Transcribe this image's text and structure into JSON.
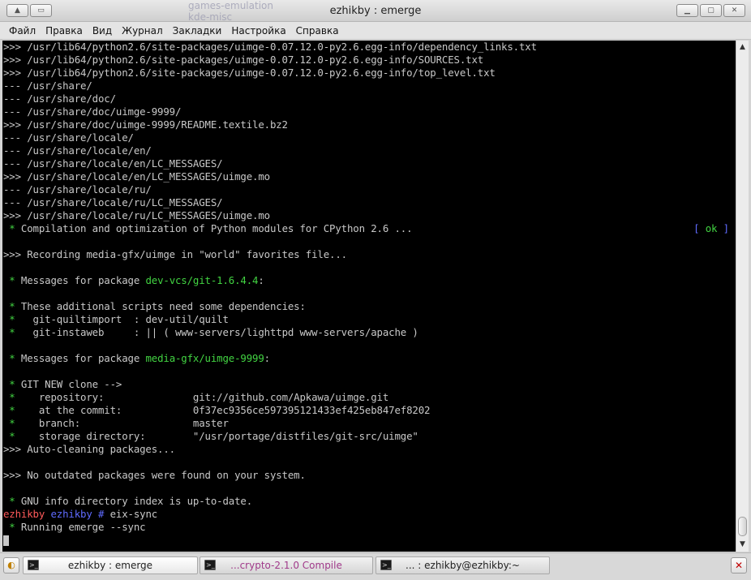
{
  "window": {
    "title": "ezhikby : emerge",
    "bg_items": [
      "games-emulation",
      "kde-misc"
    ]
  },
  "menu": [
    "Файл",
    "Правка",
    "Вид",
    "Журнал",
    "Закладки",
    "Настройка",
    "Справка"
  ],
  "terminal": {
    "lines": [
      [
        {
          "t": ">>> /usr/lib64/python2.6/site-packages/uimge-0.07.12.0-py2.6.egg-info/dependency_links.txt"
        }
      ],
      [
        {
          "t": ">>> /usr/lib64/python2.6/site-packages/uimge-0.07.12.0-py2.6.egg-info/SOURCES.txt"
        }
      ],
      [
        {
          "t": ">>> /usr/lib64/python2.6/site-packages/uimge-0.07.12.0-py2.6.egg-info/top_level.txt"
        }
      ],
      [
        {
          "t": "--- /usr/share/"
        }
      ],
      [
        {
          "t": "--- /usr/share/doc/"
        }
      ],
      [
        {
          "t": "--- /usr/share/doc/uimge-9999/"
        }
      ],
      [
        {
          "t": ">>> /usr/share/doc/uimge-9999/README.textile.bz2"
        }
      ],
      [
        {
          "t": "--- /usr/share/locale/"
        }
      ],
      [
        {
          "t": "--- /usr/share/locale/en/"
        }
      ],
      [
        {
          "t": "--- /usr/share/locale/en/LC_MESSAGES/"
        }
      ],
      [
        {
          "t": ">>> /usr/share/locale/en/LC_MESSAGES/uimge.mo"
        }
      ],
      [
        {
          "t": "--- /usr/share/locale/ru/"
        }
      ],
      [
        {
          "t": "--- /usr/share/locale/ru/LC_MESSAGES/"
        }
      ],
      [
        {
          "t": ">>> /usr/share/locale/ru/LC_MESSAGES/uimge.mo"
        }
      ],
      [
        {
          "t": " *",
          "c": "g"
        },
        {
          "t": " Compilation and optimization of Python modules for CPython 2.6 ..."
        },
        {
          "t": "[ ",
          "c": "b",
          "ok": true
        }
      ],
      [
        {
          "t": ""
        }
      ],
      [
        {
          "t": ">>> Recording media-gfx/uimge in \"world\" favorites file..."
        }
      ],
      [
        {
          "t": ""
        }
      ],
      [
        {
          "t": " *",
          "c": "g"
        },
        {
          "t": " Messages for package "
        },
        {
          "t": "dev-vcs/git-1.6.4.4",
          "c": "g"
        },
        {
          "t": ":"
        }
      ],
      [
        {
          "t": ""
        }
      ],
      [
        {
          "t": " *",
          "c": "g"
        },
        {
          "t": " These additional scripts need some dependencies:"
        }
      ],
      [
        {
          "t": " *",
          "c": "g"
        },
        {
          "t": "   git-quiltimport  : dev-util/quilt"
        }
      ],
      [
        {
          "t": " *",
          "c": "g"
        },
        {
          "t": "   git-instaweb     : || ( www-servers/lighttpd www-servers/apache )"
        }
      ],
      [
        {
          "t": ""
        }
      ],
      [
        {
          "t": " *",
          "c": "g"
        },
        {
          "t": " Messages for package "
        },
        {
          "t": "media-gfx/uimge-9999",
          "c": "g"
        },
        {
          "t": ":"
        }
      ],
      [
        {
          "t": ""
        }
      ],
      [
        {
          "t": " *",
          "c": "g"
        },
        {
          "t": " GIT NEW clone -->"
        }
      ],
      [
        {
          "t": " *",
          "c": "g"
        },
        {
          "t": "    repository:               git://github.com/Apkawa/uimge.git"
        }
      ],
      [
        {
          "t": " *",
          "c": "g"
        },
        {
          "t": "    at the commit:            0f37ec9356ce597395121433ef425eb847ef8202"
        }
      ],
      [
        {
          "t": " *",
          "c": "g"
        },
        {
          "t": "    branch:                   master"
        }
      ],
      [
        {
          "t": " *",
          "c": "g"
        },
        {
          "t": "    storage directory:        \"/usr/portage/distfiles/git-src/uimge\""
        }
      ],
      [
        {
          "t": ">>> Auto-cleaning packages..."
        }
      ],
      [
        {
          "t": ""
        }
      ],
      [
        {
          "t": ">>> No outdated packages were found on your system."
        }
      ],
      [
        {
          "t": ""
        }
      ],
      [
        {
          "t": " *",
          "c": "g"
        },
        {
          "t": " GNU info directory index is up-to-date."
        }
      ],
      [
        {
          "t": "ezhikby",
          "c": "r"
        },
        {
          "t": " ezhikby #",
          "c": "b"
        },
        {
          "t": " eix-sync"
        }
      ],
      [
        {
          "t": " *",
          "c": "g"
        },
        {
          "t": " Running emerge --sync"
        }
      ]
    ],
    "ok_text": "ok",
    "ok_close": " ]"
  },
  "tabs": [
    {
      "label": "ezhikby : emerge",
      "active": true
    },
    {
      "label": "...crypto-2.1.0 Compile",
      "active": false
    },
    {
      "label": "... : ezhikby@ezhikby:~",
      "active": false
    }
  ],
  "colors": {
    "terminal_bg": "#000000",
    "green": "#42d442",
    "blue": "#5f6bff",
    "red": "#ff5a5a"
  }
}
